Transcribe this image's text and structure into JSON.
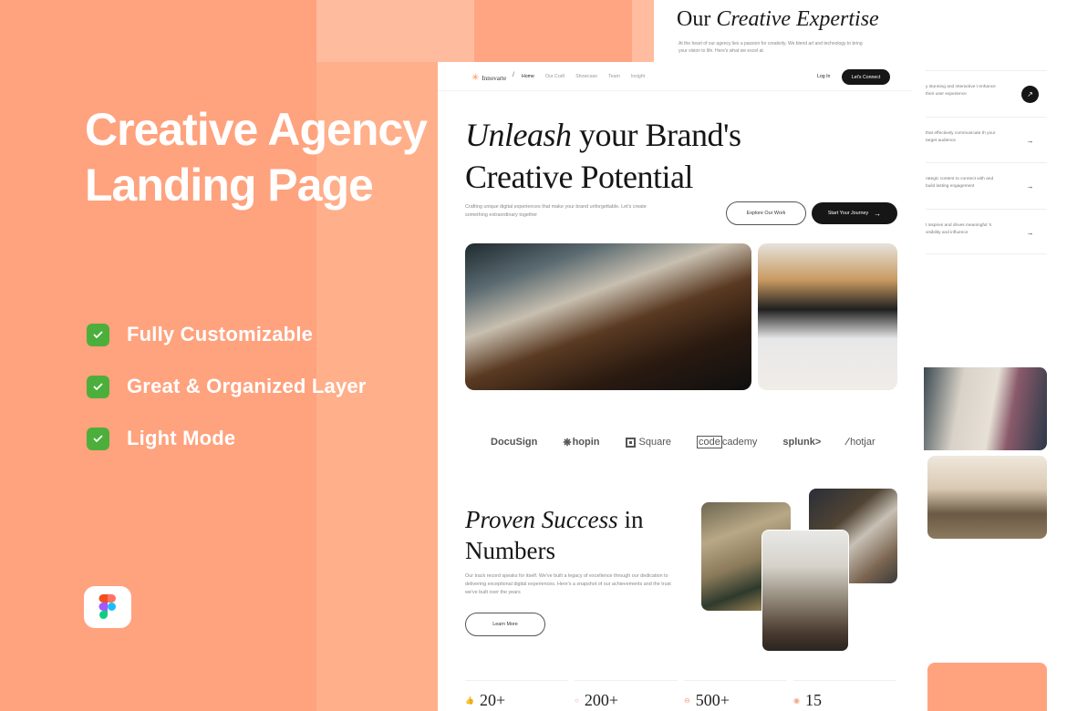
{
  "promo": {
    "title_line1": "Creative Agency",
    "title_line2": "Landing Page",
    "features": [
      {
        "label": "Fully Customizable",
        "icon": "check-icon"
      },
      {
        "label": "Great & Organized Layer",
        "icon": "check-icon"
      },
      {
        "label": "Light Mode",
        "icon": "check-icon"
      }
    ],
    "badge_icon": "figma-logo-icon"
  },
  "expertise": {
    "title_plain": "Our",
    "title_italic": "Creative Expertise",
    "description": "At the heart of our agency lies a passion for creativity. We blend art and technology to bring your vision to life. Here's what we excel at."
  },
  "services": [
    {
      "text": "y stunning and interactive t enhance their user experience",
      "arrow": "arrow-up-right-icon",
      "active": true
    },
    {
      "text": "that effectively communicate th your target audience",
      "arrow": "arrow-right-icon",
      "active": false
    },
    {
      "text": "rategic content to connect with and build lasting engagement",
      "arrow": "arrow-right-icon",
      "active": false
    },
    {
      "text": "t inspires and drives meaningful 's visibility and influence",
      "arrow": "arrow-right-icon",
      "active": false
    }
  ],
  "nav": {
    "brand": "Innovarte",
    "separator": "/",
    "links": [
      "Home",
      "Our Craft",
      "Showcase",
      "Team",
      "Insight"
    ],
    "active_link": "Home",
    "login": "Log In",
    "cta": "Let's Connect"
  },
  "hero": {
    "title_italic": "Unleash",
    "title_rest": "your Brand's",
    "title_line2": "Creative Potential",
    "description": "Crafting unique digital experiences that make your brand unforgettable. Let's create something extraordinary together",
    "secondary_button": "Explore Our Work",
    "primary_button": "Start Your Journey"
  },
  "brands": [
    "DocuSign",
    "hopin",
    "Square",
    "code",
    "cademy",
    "splunk>",
    "hotjar"
  ],
  "success": {
    "title_italic": "Proven Success",
    "title_rest": "in",
    "title_line2": "Numbers",
    "description": "Our track record speaks for itself. We've built a legacy of excellence through our dedication to delivering exceptional digital experiences. Here's a snapshot of our achievements and the trust we've built over the years",
    "button": "Learn More"
  },
  "stats": [
    {
      "value": "20+",
      "icon": "thumbs-up-icon"
    },
    {
      "value": "200+",
      "icon": "smile-icon"
    },
    {
      "value": "500+",
      "icon": "briefcase-icon"
    },
    {
      "value": "15",
      "icon": "award-icon"
    }
  ],
  "colors": {
    "accent": "#ffa380",
    "check_green": "#4caf3c",
    "dark": "#161616"
  }
}
